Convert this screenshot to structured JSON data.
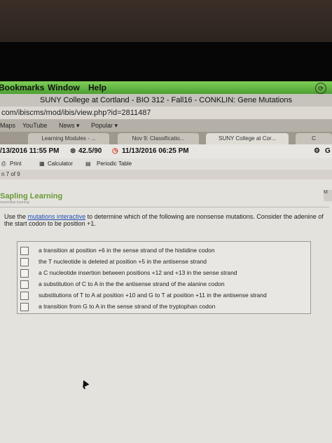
{
  "menubar": {
    "items": [
      "Bookmarks",
      "Window",
      "Help"
    ]
  },
  "window_title": "SUNY College at Cortland - BIO 312 - Fall16 - CONKLIN: Gene Mutations",
  "url": "com/ibiscms/mod/ibis/view.php?id=2811487",
  "bookmarks": [
    "Maps",
    "YouTube",
    "News ▾",
    "Popular ▾"
  ],
  "tabs": [
    "Learning Modules - ...",
    "Nov 9: Classificatio...",
    "SUNY College at Cor...",
    "C"
  ],
  "status": {
    "start": "/13/2016 11:55 PM",
    "score": "42.5/90",
    "due": "11/13/2016 06:25 PM",
    "right": "G"
  },
  "toolbar": {
    "print": "Print",
    "calculator": "Calculator",
    "periodic": "Periodic Table"
  },
  "pager": "n 7 of 9",
  "logo": {
    "name": "Sapling Learning",
    "sub": "macmillan learning"
  },
  "right_edge": "M",
  "question": {
    "prefix": "Use the ",
    "link": "mutations interactive",
    "suffix": " to determine which of the following are nonsense mutations. Consider the adenine of the start codon to be position +1."
  },
  "choices": [
    "a transition at position +6 in the sense strand of the histidine codon",
    "the T nucleotide is deleted at position +5 in the antisense strand",
    "a C nucleotide insertion between positions +12 and +13 in the sense strand",
    "a substitution of C to A in the the antisense strand of the alanine codon",
    "substitutions of T to A at position +10 and G to T at position +11 in the antisense strand",
    "a transition from G to A in the sense strand of the tryptophan codon"
  ]
}
